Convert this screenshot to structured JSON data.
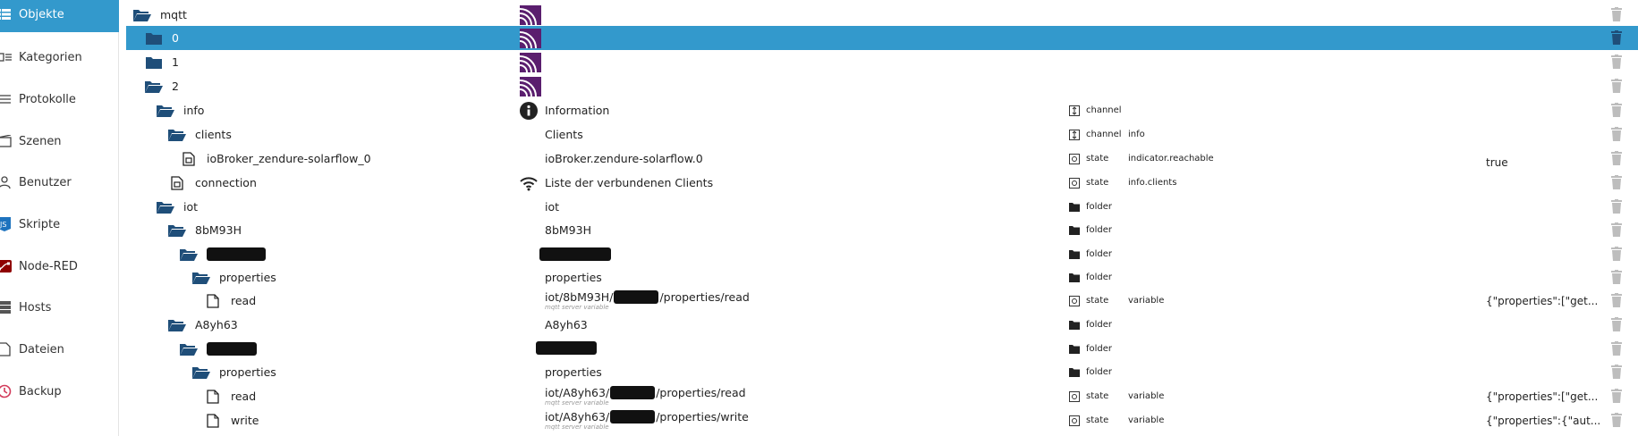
{
  "sidebar": {
    "items": [
      {
        "label": "Objekte",
        "icon": "list-icon",
        "active": true
      },
      {
        "label": "Kategorien",
        "icon": "categories-icon"
      },
      {
        "label": "Protokolle",
        "icon": "log-icon"
      },
      {
        "label": "Szenen",
        "icon": "scenes-icon"
      },
      {
        "label": "Benutzer",
        "icon": "user-icon"
      },
      {
        "label": "Skripte",
        "icon": "javascript-icon"
      },
      {
        "label": "Node-RED",
        "icon": "node-red-icon"
      },
      {
        "label": "Hosts",
        "icon": "hosts-icon"
      },
      {
        "label": "Dateien",
        "icon": "files-icon"
      },
      {
        "label": "Backup",
        "icon": "backup-icon"
      }
    ]
  },
  "tree": {
    "rows": [
      {
        "id": "mqtt",
        "icon": "folder-open-icon",
        "name_icon": "mqtt-logo-icon"
      },
      {
        "id": "0",
        "icon": "folder-icon",
        "name_icon": "mqtt-logo-icon",
        "selected": true
      },
      {
        "id": "1",
        "icon": "folder-icon",
        "name_icon": "mqtt-logo-icon"
      },
      {
        "id": "2",
        "icon": "folder-open-icon",
        "name_icon": "mqtt-logo-icon"
      },
      {
        "id": "info",
        "icon": "folder-open-icon",
        "name": "Information",
        "name_icon": "info-icon",
        "type": "channel",
        "type_icon": "channel-icon"
      },
      {
        "id": "clients",
        "icon": "folder-open-icon",
        "name": "Clients",
        "type": "channel",
        "type_icon": "channel-icon",
        "role": "info"
      },
      {
        "id": "ioBroker_zendure-solarflow_0",
        "icon": "state-file-icon",
        "name": "ioBroker.zendure-solarflow.0",
        "type": "state",
        "type_icon": "state-icon",
        "role": "indicator.reachable",
        "value": "true"
      },
      {
        "id": "connection",
        "icon": "state-file-icon",
        "name": "Liste der verbundenen Clients",
        "name_icon": "wifi-icon",
        "type": "state",
        "type_icon": "state-icon",
        "role": "info.clients"
      },
      {
        "id": "iot",
        "icon": "folder-open-icon",
        "name": "iot",
        "type": "folder",
        "type_icon": "folder-small-icon"
      },
      {
        "id": "8bM93H",
        "icon": "folder-open-icon",
        "name": "8bM93H",
        "type": "folder",
        "type_icon": "folder-small-icon"
      },
      {
        "id": "",
        "icon": "folder-open-icon",
        "redacted_id": true,
        "redacted_name": true,
        "type": "folder",
        "type_icon": "folder-small-icon"
      },
      {
        "id": "properties",
        "icon": "folder-open-icon",
        "name": "properties",
        "type": "folder",
        "type_icon": "folder-small-icon"
      },
      {
        "id": "read",
        "icon": "file-icon",
        "name_parts": [
          "iot/8bM93H/",
          "/properties/read"
        ],
        "sub": "mqtt server variable",
        "type": "state",
        "type_icon": "state-icon",
        "role": "variable",
        "value": "{\"properties\":[\"get..."
      },
      {
        "id": "A8yh63",
        "icon": "folder-open-icon",
        "name": "A8yh63",
        "type": "folder",
        "type_icon": "folder-small-icon"
      },
      {
        "id": "",
        "icon": "folder-open-icon",
        "redacted_id": true,
        "redacted_name": true,
        "type": "folder",
        "type_icon": "folder-small-icon"
      },
      {
        "id": "properties",
        "icon": "folder-open-icon",
        "name": "properties",
        "type": "folder",
        "type_icon": "folder-small-icon"
      },
      {
        "id": "read",
        "icon": "file-icon",
        "name_parts": [
          "iot/A8yh63/",
          "/properties/read"
        ],
        "sub": "mqtt server variable",
        "type": "state",
        "type_icon": "state-icon",
        "role": "variable",
        "value": "{\"properties\":[\"get..."
      },
      {
        "id": "write",
        "icon": "file-icon",
        "name_parts": [
          "iot/A8yh63/",
          "/properties/write"
        ],
        "sub": "mqtt server variable",
        "type": "state",
        "type_icon": "state-icon",
        "role": "variable",
        "value": "{\"properties\":{\"aut..."
      }
    ]
  },
  "colors": {
    "accent": "#3399cc",
    "folder": "#1f4e79",
    "mqtt_logo": "#5a1e6e",
    "delete_icon": "#bdbdbd"
  }
}
